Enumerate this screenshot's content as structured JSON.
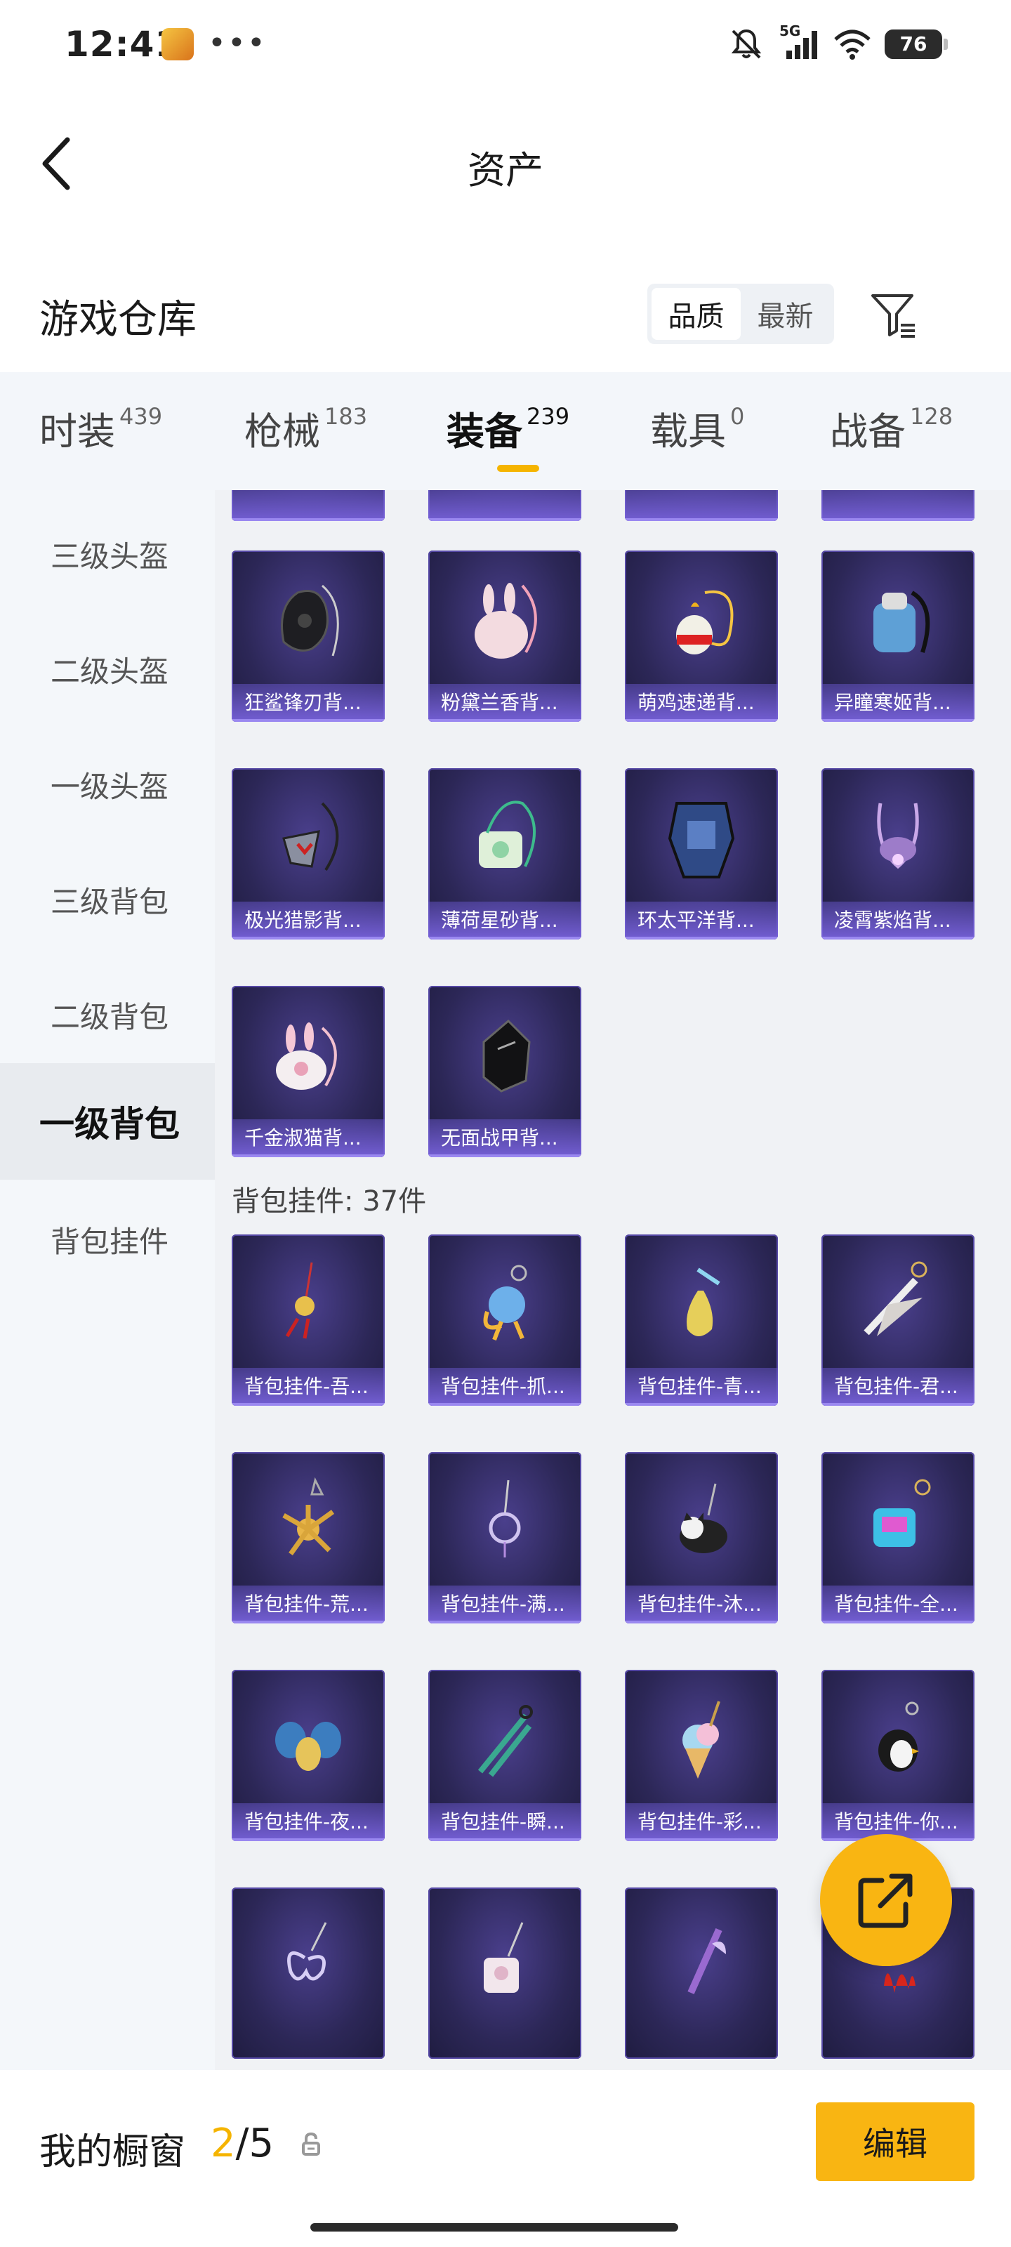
{
  "status_bar": {
    "time": "12:41",
    "network": "5G",
    "battery": "76"
  },
  "header": {
    "title": "资产"
  },
  "warehouse": {
    "title": "游戏仓库",
    "sort_options": [
      {
        "label": "品质"
      },
      {
        "label": "最新"
      }
    ]
  },
  "tabs": [
    {
      "label": "时装",
      "count": "439"
    },
    {
      "label": "枪械",
      "count": "183"
    },
    {
      "label": "装备",
      "count": "239"
    },
    {
      "label": "载具",
      "count": "0"
    },
    {
      "label": "战备",
      "count": "128"
    }
  ],
  "sidebar": {
    "items": [
      {
        "label": "三级头盔"
      },
      {
        "label": "二级头盔"
      },
      {
        "label": "一级头盔"
      },
      {
        "label": "三级背包"
      },
      {
        "label": "二级背包"
      },
      {
        "label": "一级背包"
      },
      {
        "label": "背包挂件"
      }
    ]
  },
  "backpacks": [
    {
      "name": "狂鲨锋刃背..."
    },
    {
      "name": "粉黛兰香背..."
    },
    {
      "name": "萌鸡速递背..."
    },
    {
      "name": "异瞳寒姬背..."
    },
    {
      "name": "极光猎影背..."
    },
    {
      "name": "薄荷星砂背..."
    },
    {
      "name": "环太平洋背..."
    },
    {
      "name": "凌霄紫焰背..."
    },
    {
      "name": "千金淑猫背..."
    },
    {
      "name": "无面战甲背..."
    }
  ],
  "pendant_section": {
    "title": "背包挂件: 37件"
  },
  "pendants": [
    {
      "name": "背包挂件-吾..."
    },
    {
      "name": "背包挂件-抓..."
    },
    {
      "name": "背包挂件-青..."
    },
    {
      "name": "背包挂件-君..."
    },
    {
      "name": "背包挂件-荒..."
    },
    {
      "name": "背包挂件-满..."
    },
    {
      "name": "背包挂件-沐..."
    },
    {
      "name": "背包挂件-全..."
    },
    {
      "name": "背包挂件-夜..."
    },
    {
      "name": "背包挂件-瞬..."
    },
    {
      "name": "背包挂件-彩..."
    },
    {
      "name": "背包挂件-你..."
    },
    {
      "name": ""
    },
    {
      "name": ""
    },
    {
      "name": ""
    },
    {
      "name": ""
    }
  ],
  "bottom_bar": {
    "label": "我的橱窗",
    "current": "2",
    "separator": "/",
    "total": "5",
    "edit_label": "编辑"
  },
  "colors": {
    "accent": "#f9b512",
    "card_bg": "#2c2757",
    "card_label": "#7862dc"
  }
}
